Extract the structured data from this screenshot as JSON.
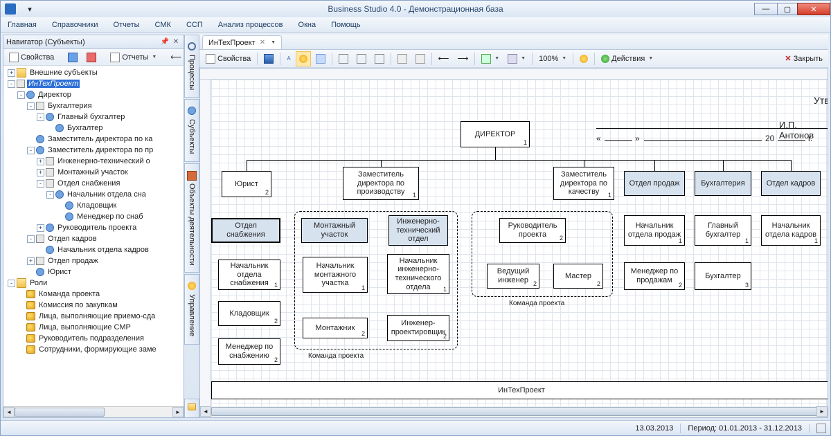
{
  "app": {
    "title": "Business Studio 4.0 - Демонстрационная база"
  },
  "menu": [
    "Главная",
    "Справочники",
    "Отчеты",
    "СМК",
    "ССП",
    "Анализ процессов",
    "Окна",
    "Помощь"
  ],
  "navigator": {
    "title": "Навигатор (Субъекты)",
    "toolbar": {
      "properties": "Свойства",
      "reports": "Отчеты"
    },
    "tree": [
      {
        "l": 0,
        "exp": "+",
        "ico": "folder",
        "label": "Внешние субъекты"
      },
      {
        "l": 0,
        "exp": "-",
        "ico": "org",
        "label": "ИнТехПроект",
        "sel": true
      },
      {
        "l": 1,
        "exp": "-",
        "ico": "person",
        "label": "Директор"
      },
      {
        "l": 2,
        "exp": "-",
        "ico": "org",
        "label": "Бухгалтерия"
      },
      {
        "l": 3,
        "exp": "-",
        "ico": "person",
        "label": "Главный бухгалтер"
      },
      {
        "l": 4,
        "exp": "",
        "ico": "person",
        "label": "Бухгалтер"
      },
      {
        "l": 2,
        "exp": "",
        "ico": "person",
        "label": "Заместитель директора по ка"
      },
      {
        "l": 2,
        "exp": "-",
        "ico": "person",
        "label": "Заместитель директора по пр"
      },
      {
        "l": 3,
        "exp": "+",
        "ico": "org",
        "label": "Инженерно-технический о"
      },
      {
        "l": 3,
        "exp": "+",
        "ico": "org",
        "label": "Монтажный участок"
      },
      {
        "l": 3,
        "exp": "-",
        "ico": "org",
        "label": "Отдел снабжения"
      },
      {
        "l": 4,
        "exp": "-",
        "ico": "person",
        "label": "Начальник отдела сна"
      },
      {
        "l": 5,
        "exp": "",
        "ico": "person",
        "label": "Кладовщик"
      },
      {
        "l": 5,
        "exp": "",
        "ico": "person",
        "label": "Менеджер по снаб"
      },
      {
        "l": 3,
        "exp": "+",
        "ico": "person",
        "label": "Руководитель проекта"
      },
      {
        "l": 2,
        "exp": "-",
        "ico": "org",
        "label": "Отдел кадров"
      },
      {
        "l": 3,
        "exp": "",
        "ico": "person",
        "label": "Начальник отдела кадров"
      },
      {
        "l": 2,
        "exp": "+",
        "ico": "org",
        "label": "Отдел продаж"
      },
      {
        "l": 2,
        "exp": "",
        "ico": "person",
        "label": "Юрист"
      },
      {
        "l": 0,
        "exp": "-",
        "ico": "folder",
        "label": "Роли"
      },
      {
        "l": 1,
        "exp": "",
        "ico": "role",
        "label": "Команда проекта"
      },
      {
        "l": 1,
        "exp": "",
        "ico": "role",
        "label": "Комиссия по закупкам"
      },
      {
        "l": 1,
        "exp": "",
        "ico": "role",
        "label": "Лица, выполняющие приемо-сда"
      },
      {
        "l": 1,
        "exp": "",
        "ico": "role",
        "label": "Лица, выполняющие СМР"
      },
      {
        "l": 1,
        "exp": "",
        "ico": "role",
        "label": "Руководитель подразделения"
      },
      {
        "l": 1,
        "exp": "",
        "ico": "role",
        "label": "Сотрудники, формирующие заме"
      }
    ]
  },
  "side_tabs": [
    "Процессы",
    "Субъекты",
    "Объекты деятельности",
    "Управление"
  ],
  "doc": {
    "tab": "ИнТехПроект",
    "toolbar": {
      "properties": "Свойства",
      "zoom": "100%",
      "actions": "Действия",
      "close": "Закрыть"
    }
  },
  "diagram": {
    "approve": "Утверждаю",
    "signer": "И.П. Антонов",
    "date_tpl_left": "«",
    "date_tpl_mid": "»",
    "date_year": "20",
    "date_suffix": "г.",
    "footer": "ИнТехПроект",
    "team_project": "Команда проекта",
    "boxes": {
      "director": {
        "t": "ДИРЕКТОР",
        "n": "1"
      },
      "jurist": {
        "t": "Юрист",
        "n": "2"
      },
      "zam_prod": {
        "t": "Заместитель директора по производству",
        "n": "1"
      },
      "zam_qual": {
        "t": "Заместитель директора по качеству",
        "n": "1"
      },
      "otdel_prodazh": {
        "t": "Отдел продаж",
        "n": ""
      },
      "buh": {
        "t": "Бухгалтерия",
        "n": ""
      },
      "otdel_kadrov": {
        "t": "Отдел кадров",
        "n": ""
      },
      "otdel_snab": {
        "t": "Отдел снабжения",
        "n": ""
      },
      "mont_uch": {
        "t": "Монтажный участок",
        "n": ""
      },
      "inj_tech": {
        "t": "Инженерно-технический отдел",
        "n": ""
      },
      "ruk_proj": {
        "t": "Руководитель проекта",
        "n": "2"
      },
      "nach_prodazh": {
        "t": "Начальник отдела продаж",
        "n": "1"
      },
      "glav_buh": {
        "t": "Главный бухгалтер",
        "n": "1"
      },
      "nach_kadrov": {
        "t": "Начальник отдела кадров",
        "n": "1"
      },
      "nach_snab": {
        "t": "Начальник отдела снабжения",
        "n": "1"
      },
      "nach_mont": {
        "t": "Начальник монтажного участка",
        "n": "1"
      },
      "nach_inj": {
        "t": "Начальник инженерно-технического отдела",
        "n": "1"
      },
      "ved_inj": {
        "t": "Ведущий инженер",
        "n": "2"
      },
      "master": {
        "t": "Мастер",
        "n": "2"
      },
      "men_prod": {
        "t": "Менеджер по продажам",
        "n": "2"
      },
      "buhгалтер": {
        "t": "Бухгалтер",
        "n": "3"
      },
      "kladov": {
        "t": "Кладовщик",
        "n": "2"
      },
      "montazh": {
        "t": "Монтажник",
        "n": "2"
      },
      "inj_proekt": {
        "t": "Инженер-проектировщик",
        "n": "2"
      },
      "men_snab": {
        "t": "Менеджер по снабжению",
        "n": "2"
      }
    }
  },
  "statusbar": {
    "date": "13.03.2013",
    "period": "Период: 01.01.2013 - 31.12.2013"
  }
}
